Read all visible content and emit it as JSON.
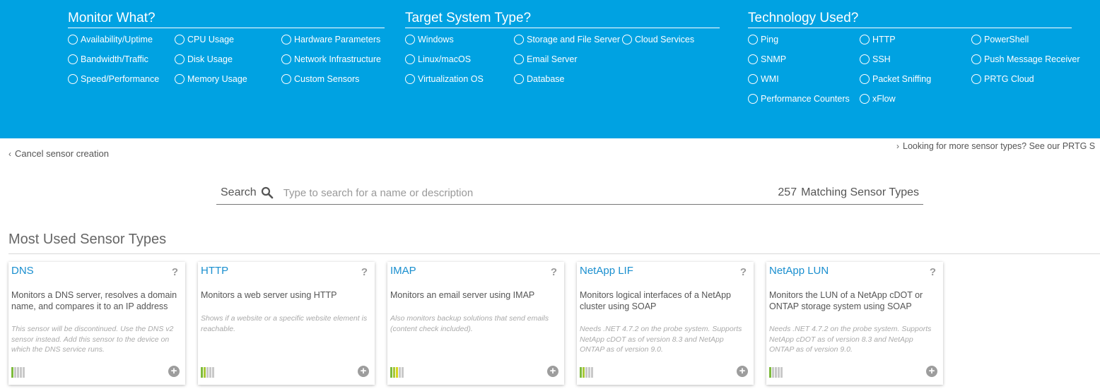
{
  "filters": {
    "monitor": {
      "title": "Monitor What?",
      "options": [
        "Availability/Uptime",
        "CPU Usage",
        "Hardware Parameters",
        "Bandwidth/Traffic",
        "Disk Usage",
        "Network Infrastructure",
        "Speed/Performance",
        "Memory Usage",
        "Custom Sensors"
      ]
    },
    "target": {
      "title": "Target System Type?",
      "options": [
        "Windows",
        "Storage and File Server",
        "Cloud Services",
        "Linux/macOS",
        "Email Server",
        "Virtualization OS",
        "Database"
      ]
    },
    "technology": {
      "title": "Technology Used?",
      "options": [
        "Ping",
        "HTTP",
        "PowerShell",
        "SNMP",
        "SSH",
        "Push Message Receiver",
        "WMI",
        "Packet Sniffing",
        "PRTG Cloud",
        "Performance Counters",
        "xFlow"
      ]
    }
  },
  "nav": {
    "cancel": "Cancel sensor creation",
    "more": "Looking for more sensor types? See our PRTG S"
  },
  "search": {
    "label": "Search",
    "placeholder": "Type to search for a name or description",
    "count": "257",
    "count_label": "Matching Sensor Types"
  },
  "section": {
    "title": "Most Used Sensor Types"
  },
  "cards": [
    {
      "title": "DNS",
      "help": "?",
      "description": "Monitors a DNS server, resolves a domain name, and compares it to an IP address",
      "note": "This sensor will be discontinued. Use the DNS v2 sensor instead. Add this sensor to the device on which the DNS service runs.",
      "performance_level": 1,
      "add": "+"
    },
    {
      "title": "HTTP",
      "help": "?",
      "description": "Monitors a web server using HTTP",
      "note": "Shows if a website or a specific website element is reachable.",
      "performance_level": 2,
      "add": "+"
    },
    {
      "title": "IMAP",
      "help": "?",
      "description": "Monitors an email server using IMAP",
      "note": "Also monitors backup solutions that send emails (content check included).",
      "performance_level": 3,
      "add": "+"
    },
    {
      "title": "NetApp LIF",
      "help": "?",
      "description": "Monitors logical interfaces of a NetApp cluster using SOAP",
      "note": "Needs .NET 4.7.2 on the probe system. Supports NetApp cDOT as of version 8.3 and NetApp ONTAP as of version 9.0.",
      "performance_level": 2,
      "add": "+"
    },
    {
      "title": "NetApp LUN",
      "help": "?",
      "description": "Monitors the LUN of a NetApp cDOT or ONTAP storage system using SOAP",
      "note": "Needs .NET 4.7.2 on the probe system. Supports NetApp cDOT as of version 8.3 and NetApp ONTAP as of version 9.0.",
      "performance_level": 1,
      "add": "+"
    }
  ],
  "colors": {
    "banner": "#00a2e2",
    "link": "#1a8fcf",
    "bar_levels": [
      "#7dbb3c",
      "#a7c83a",
      "#d6d61e",
      "#f0c419",
      "#e38b1a"
    ],
    "bar_empty": "#c9c9c9"
  },
  "icons": {
    "search": "search-icon",
    "cancel": "chevron-left-icon",
    "more": "chevron-right-icon",
    "help": "question-icon",
    "add": "plus-circle-icon"
  }
}
